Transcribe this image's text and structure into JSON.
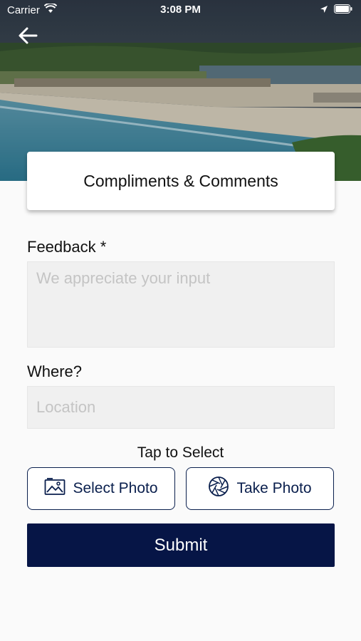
{
  "status_bar": {
    "carrier": "Carrier",
    "time": "3:08 PM"
  },
  "header": {
    "title": "Compliments & Comments"
  },
  "form": {
    "feedback_label": "Feedback *",
    "feedback_placeholder": "We appreciate your input",
    "where_label": "Where?",
    "location_placeholder": "Location",
    "tap_to_select": "Tap to Select",
    "select_photo_label": "Select Photo",
    "take_photo_label": "Take Photo",
    "submit_label": "Submit"
  },
  "colors": {
    "primary": "#061546",
    "field_bg": "#f0f0f0",
    "page_bg": "#fafafa"
  },
  "icons": [
    "back-arrow-icon",
    "wifi-icon",
    "location-arrow-icon",
    "battery-icon",
    "image-icon",
    "camera-shutter-icon"
  ]
}
